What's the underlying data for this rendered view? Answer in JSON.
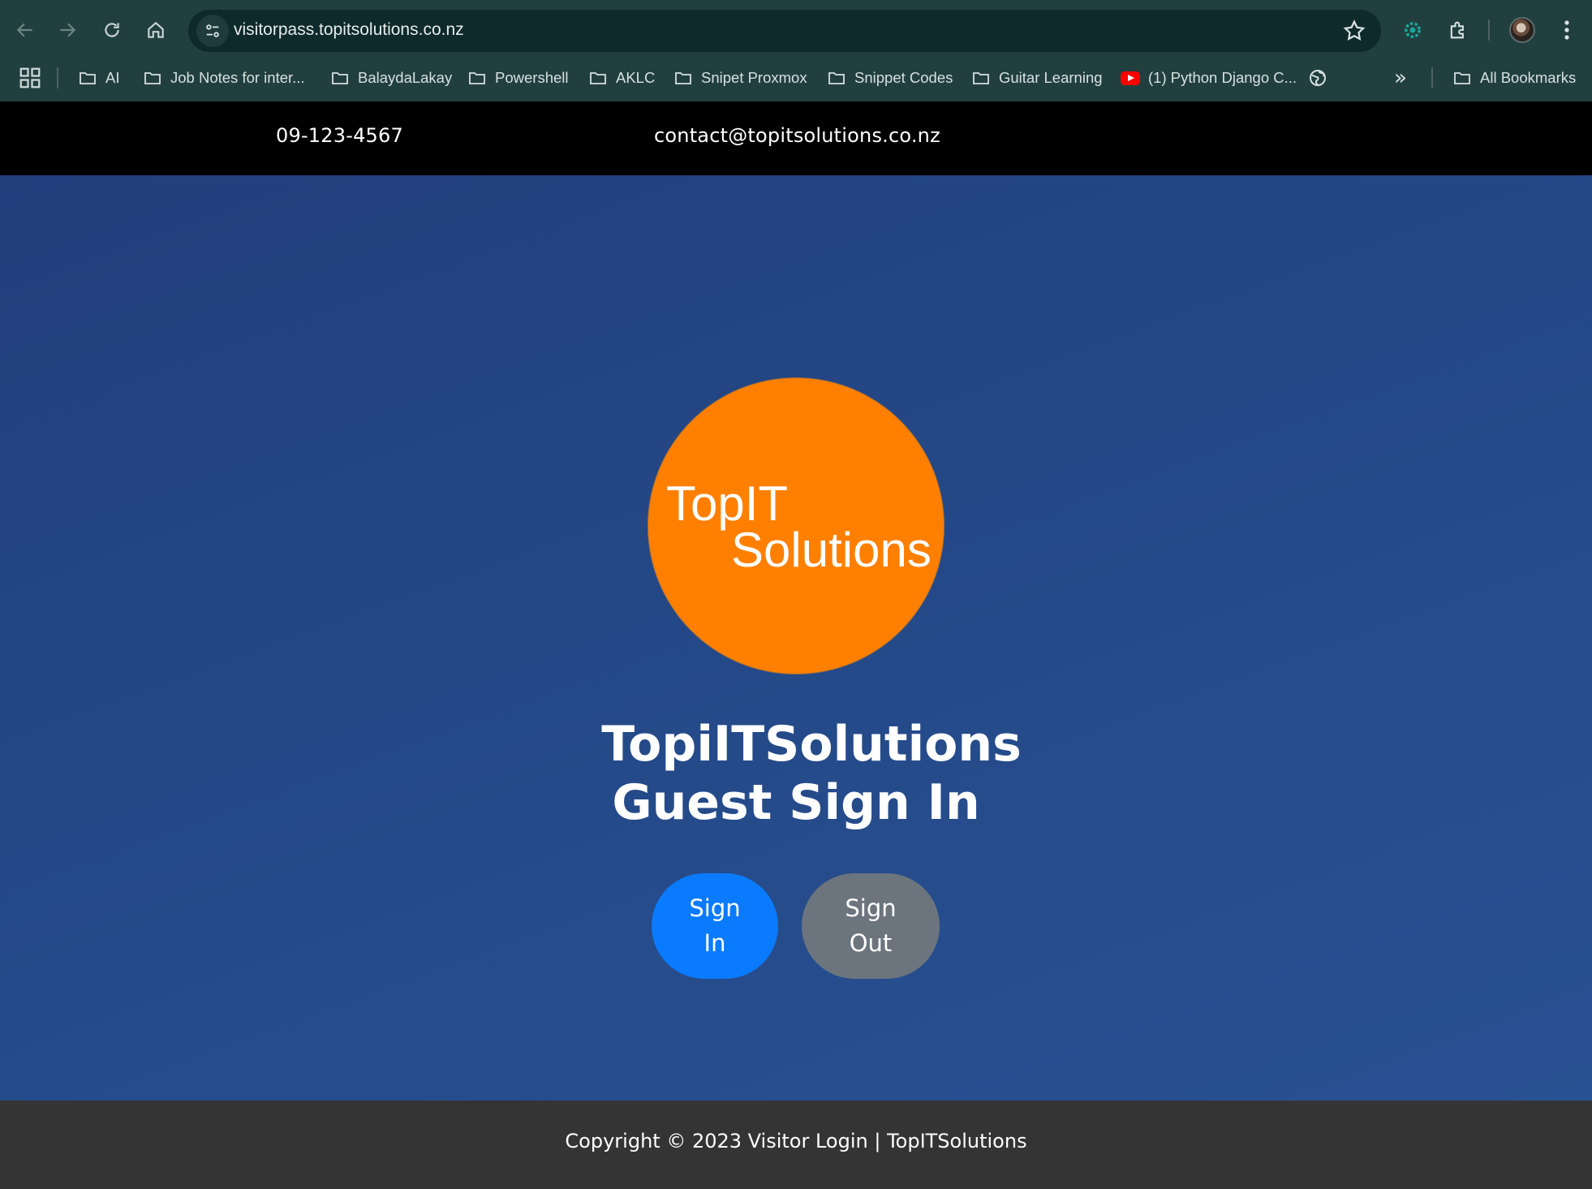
{
  "browser": {
    "url": "visitorpass.topitsolutions.co.nz",
    "bookmarks": [
      {
        "label": "AI",
        "type": "folder"
      },
      {
        "label": "Job Notes for inter...",
        "type": "folder"
      },
      {
        "label": "BalaydaLakay",
        "type": "folder"
      },
      {
        "label": "Powershell",
        "type": "folder"
      },
      {
        "label": "AKLC",
        "type": "folder"
      },
      {
        "label": "Snipet Proxmox",
        "type": "folder"
      },
      {
        "label": "Snippet Codes",
        "type": "folder"
      },
      {
        "label": "Guitar Learning",
        "type": "folder"
      },
      {
        "label": "(1) Python Django C...",
        "type": "youtube"
      }
    ],
    "all_bookmarks": "All Bookmarks"
  },
  "topbar": {
    "phone": "09-123-4567",
    "email": "contact@topitsolutions.co.nz"
  },
  "logo": {
    "line1": "TopIT",
    "line2": "Solutions",
    "color": "#ff7f00"
  },
  "heading": {
    "line1": "TopiITSolutions",
    "line2": "Guest Sign In"
  },
  "buttons": {
    "sign_in": "Sign\nIn",
    "sign_out": "Sign\nOut",
    "sign_in_color": "#0a7bff",
    "sign_out_color": "#6c757d"
  },
  "footer": {
    "copyright": "Copyright © 2023 Visitor Login | TopITSolutions"
  }
}
